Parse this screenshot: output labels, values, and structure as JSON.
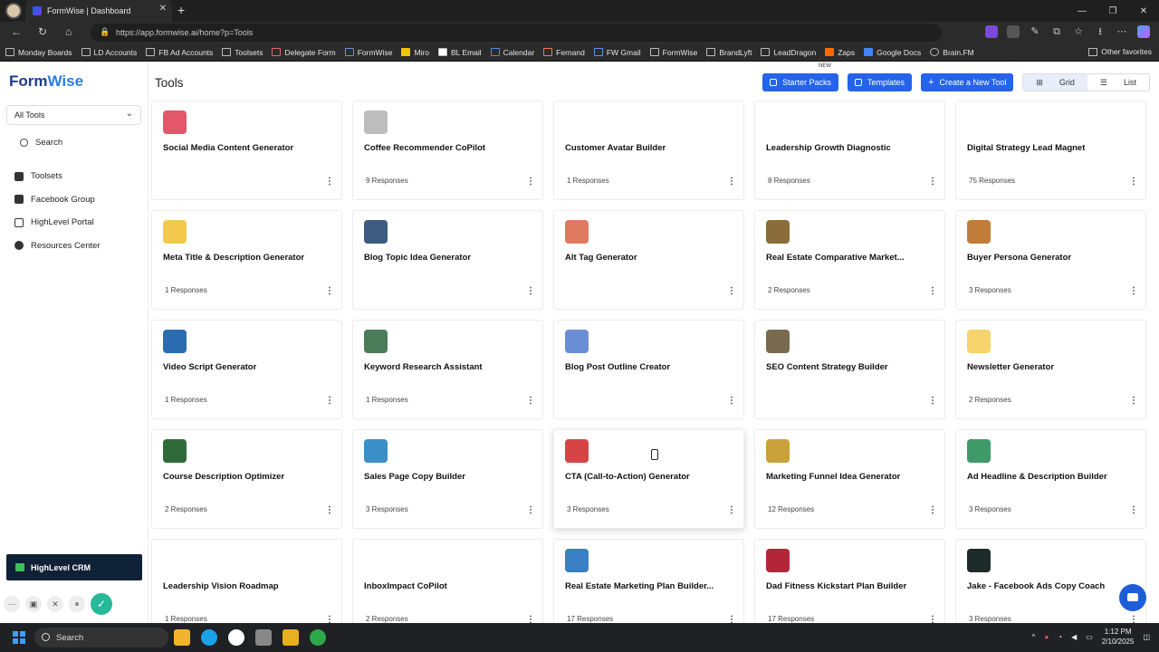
{
  "browser": {
    "tab_title": "FormWise | Dashboard",
    "url": "https://app.formwise.ai/home?p=Tools",
    "bookmarks": [
      "Monday Boards",
      "LD Accounts",
      "FB Ad Accounts",
      "Toolsets",
      "Delegate Form",
      "FormWise",
      "Miro",
      "BL Email",
      "Calendar",
      "Fernand",
      "FW Gmail",
      "FormWise",
      "BrandLyft",
      "LeadDragon",
      "Zaps",
      "Google Docs",
      "Brain.FM"
    ],
    "other_favorites": "Other favorites"
  },
  "sidebar": {
    "logo_part1": "F",
    "logo_part2": "orm",
    "logo_part3": "Wise",
    "filter_value": "All Tools",
    "search_label": "Search",
    "items": [
      {
        "label": "Toolsets",
        "icon": "grid-icon"
      },
      {
        "label": "Facebook Group",
        "icon": "facebook-icon"
      },
      {
        "label": "HighLevel Portal",
        "icon": "portal-icon"
      },
      {
        "label": "Resources Center",
        "icon": "info-icon"
      }
    ],
    "crm_label": "HighLevel CRM"
  },
  "header": {
    "title": "Tools",
    "starter_packs": "Starter Packs",
    "new_badge": "NEW",
    "templates": "Templates",
    "create_tool": "Create a New Tool",
    "view_grid": "Grid",
    "view_list": "List"
  },
  "tools": [
    {
      "name": "Social Media Content Generator",
      "responses": "",
      "color": "#e4566a"
    },
    {
      "name": "Coffee Recommender CoPilot",
      "responses": "9 Responses",
      "color": "#bdbdbd"
    },
    {
      "name": "Customer Avatar Builder",
      "responses": "1 Responses",
      "color": "#ffffff"
    },
    {
      "name": "Leadership Growth Diagnostic",
      "responses": "8 Responses",
      "color": "#ffffff"
    },
    {
      "name": "Digital Strategy Lead Magnet",
      "responses": "75 Responses",
      "color": "#ffffff"
    },
    {
      "name": "Meta Title & Description Generator",
      "responses": "1 Responses",
      "color": "#f2c94c"
    },
    {
      "name": "Blog Topic Idea Generator",
      "responses": "",
      "color": "#3d5a80"
    },
    {
      "name": "Alt Tag Generator",
      "responses": "",
      "color": "#e07a5f"
    },
    {
      "name": "Real Estate Comparative Market...",
      "responses": "2 Responses",
      "color": "#8a6d3b"
    },
    {
      "name": "Buyer Persona Generator",
      "responses": "3 Responses",
      "color": "#c27c3a"
    },
    {
      "name": "Video Script Generator",
      "responses": "1 Responses",
      "color": "#2b6cb0"
    },
    {
      "name": "Keyword Research Assistant",
      "responses": "1 Responses",
      "color": "#4a7c59"
    },
    {
      "name": "Blog Post Outline Creator",
      "responses": "",
      "color": "#6b8fd6"
    },
    {
      "name": "SEO Content Strategy Builder",
      "responses": "",
      "color": "#7a6a4f"
    },
    {
      "name": "Newsletter Generator",
      "responses": "2 Responses",
      "color": "#f6d36b"
    },
    {
      "name": "Course Description Optimizer",
      "responses": "2 Responses",
      "color": "#2f6b3a"
    },
    {
      "name": "Sales Page Copy Builder",
      "responses": "3 Responses",
      "color": "#3b8fc9"
    },
    {
      "name": "CTA (Call-to-Action) Generator",
      "responses": "3 Responses",
      "color": "#d64545"
    },
    {
      "name": "Marketing Funnel Idea Generator",
      "responses": "12 Responses",
      "color": "#c9a23b"
    },
    {
      "name": "Ad Headline & Description Builder",
      "responses": "3 Responses",
      "color": "#3f9a6a"
    },
    {
      "name": "Leadership Vision Roadmap",
      "responses": "1 Responses",
      "color": "#ffffff"
    },
    {
      "name": "InboxImpact CoPilot",
      "responses": "2 Responses",
      "color": "#ffffff"
    },
    {
      "name": "Real Estate Marketing Plan Builder...",
      "responses": "17 Responses",
      "color": "#3a7fc4"
    },
    {
      "name": "Dad Fitness Kickstart Plan Builder",
      "responses": "17 Responses",
      "color": "#b3263a"
    },
    {
      "name": "Jake - Facebook Ads Copy Coach",
      "responses": "3 Responses",
      "color": "#1d2a2a"
    }
  ],
  "taskbar": {
    "search": "Search",
    "time": "1:12 PM",
    "date": "2/10/2025"
  }
}
